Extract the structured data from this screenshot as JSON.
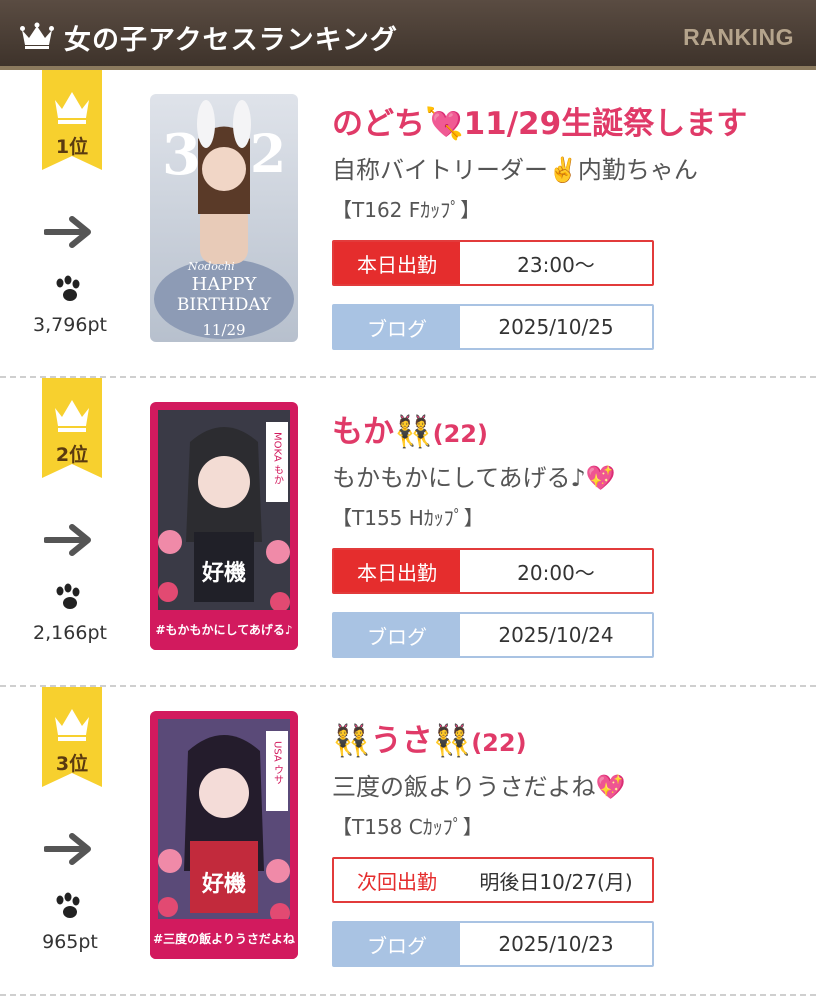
{
  "header": {
    "title": "女の子アクセスランキング",
    "tag": "RANKING",
    "crown_color": "#ffffff"
  },
  "accent": {
    "badge": "#f7d02e",
    "name": "#e03a68",
    "work": "#e52d2d",
    "blog": "#a9c3e3"
  },
  "entries": [
    {
      "rank": "1位",
      "points": "3,796pt",
      "trend_icon": "arrow-right-icon",
      "name": "のどち💘11/29生誕祭します",
      "age": "",
      "catch": "自称バイトリーダー✌️内勤ちゃん",
      "spec": "【T162 Fｶｯﾌﾟ】",
      "work_label": "本日出勤",
      "work_value": "23:00〜",
      "blog_label": "ブログ",
      "blog_value": "2025/10/25",
      "photo_text": [
        "3",
        "2",
        "HAPPY",
        "BIRTHDAY",
        "11/29",
        "Nodochi"
      ]
    },
    {
      "rank": "2位",
      "points": "2,166pt",
      "trend_icon": "arrow-right-icon",
      "name": "もか👯",
      "age": "(22)",
      "catch": "もかもかにしてあげる♪💖",
      "spec": "【T155 Hｶｯﾌﾟ】",
      "work_label": "本日出勤",
      "work_value": "20:00〜",
      "blog_label": "ブログ",
      "blog_value": "2025/10/24",
      "photo_text": [
        "MOKA もか",
        "#もかもかにしてあげる♪",
        "好機"
      ]
    },
    {
      "rank": "3位",
      "points": "965pt",
      "trend_icon": "arrow-right-icon",
      "name": "👯うさ👯",
      "age": "(22)",
      "catch": "三度の飯よりうさだよね💖",
      "spec": "【T158 Cｶｯﾌﾟ】",
      "work_label": "次回出勤",
      "work_value": "明後日10/27(月)",
      "blog_label": "ブログ",
      "blog_value": "2025/10/23",
      "photo_text": [
        "USA ウサ",
        "#三度の飯よりうさだよね",
        "好機"
      ]
    }
  ]
}
